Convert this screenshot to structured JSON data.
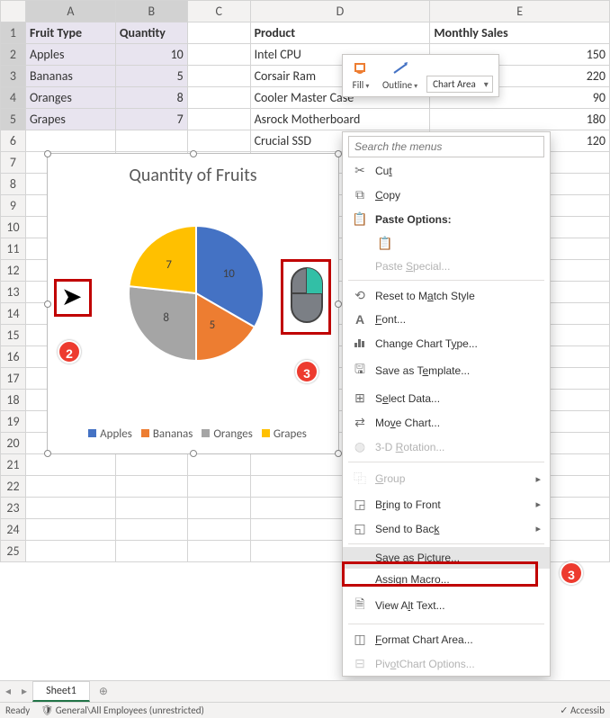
{
  "columns": [
    "A",
    "B",
    "C",
    "D",
    "E"
  ],
  "rows": 25,
  "cells": {
    "A1": "Fruit Type",
    "B1": "Quantity",
    "D1": "Product",
    "E1": "Monthly Sales",
    "A2": "Apples",
    "B2": "10",
    "D2": "Intel CPU",
    "E2": "150",
    "A3": "Bananas",
    "B3": "5",
    "D3": "Corsair Ram",
    "E3": "220",
    "A4": "Oranges",
    "B4": "8",
    "D4": "Cooler Master Case",
    "E4": "90",
    "A5": "Grapes",
    "B5": "7",
    "D5": "Asrock Motherboard",
    "E5": "180",
    "D6": "Crucial SSD",
    "E6": "120"
  },
  "selection": [
    "A1",
    "B5"
  ],
  "chart": {
    "title": "Quantity of Fruits",
    "legend": [
      "Apples",
      "Bananas",
      "Oranges",
      "Grapes"
    ],
    "colors": [
      "#4472c4",
      "#ed7d31",
      "#a5a5a5",
      "#ffc000"
    ]
  },
  "chart_data": {
    "type": "pie",
    "categories": [
      "Apples",
      "Bananas",
      "Oranges",
      "Grapes"
    ],
    "values": [
      10,
      5,
      8,
      7
    ],
    "title": "Quantity of Fruits"
  },
  "minitoolbar": {
    "fill": "Fill",
    "outline": "Outline",
    "dropdown_value": "Chart Area"
  },
  "context": {
    "search_placeholder": "Search the menus",
    "cut": "Cut",
    "copy": "Copy",
    "paste_options": "Paste Options:",
    "paste_special": "Paste Special...",
    "reset": "Reset to Match Style",
    "font": "Font...",
    "change_type": "Change Chart Type...",
    "save_template": "Save as Template...",
    "select_data": "Select Data...",
    "move_chart": "Move Chart...",
    "rotation": "3-D Rotation...",
    "group": "Group",
    "bring_front": "Bring to Front",
    "send_back": "Send to Back",
    "save_picture": "Save as Picture...",
    "assign_macro": "Assign Macro...",
    "alt_text": "View Alt Text...",
    "format_area": "Format Chart Area...",
    "pivot_opts": "PivotChart Options..."
  },
  "callouts": {
    "c2": "2",
    "c3a": "3",
    "c3b": "3"
  },
  "sheet": {
    "tab": "Sheet1",
    "ready": "Ready",
    "sensitivity": "General\\All Employees (unrestricted)",
    "access": "Accessib"
  }
}
